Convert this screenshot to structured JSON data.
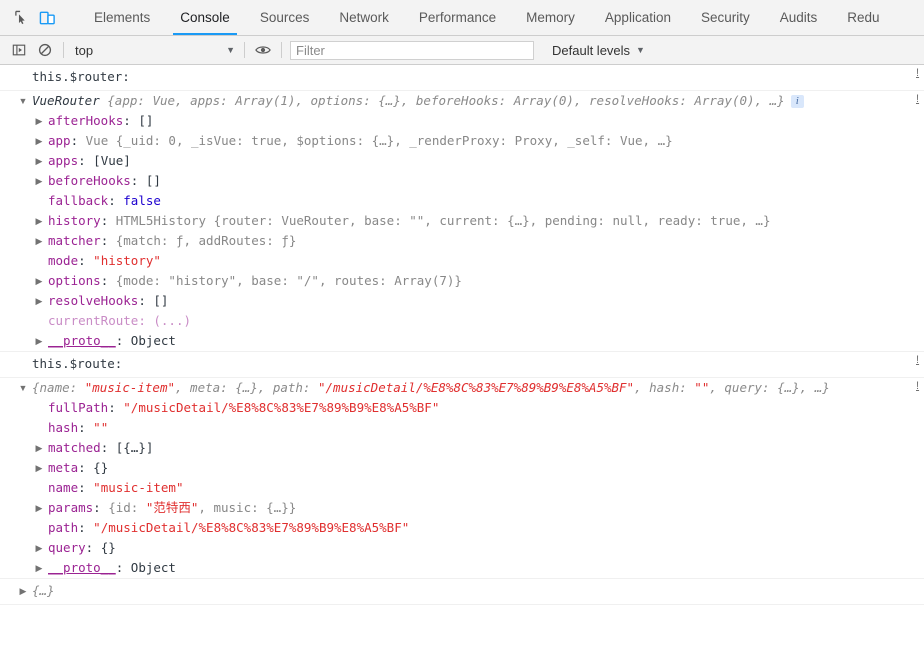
{
  "toolbar": {
    "inspect_icon": "inspect-cursor-icon",
    "device_icon": "device-toolbar-icon",
    "tabs": [
      {
        "label": "Elements",
        "active": false
      },
      {
        "label": "Console",
        "active": true
      },
      {
        "label": "Sources",
        "active": false
      },
      {
        "label": "Network",
        "active": false
      },
      {
        "label": "Performance",
        "active": false
      },
      {
        "label": "Memory",
        "active": false
      },
      {
        "label": "Application",
        "active": false
      },
      {
        "label": "Security",
        "active": false
      },
      {
        "label": "Audits",
        "active": false
      },
      {
        "label": "Redu",
        "active": false
      }
    ],
    "active_accent": "#1a9af5"
  },
  "filterbar": {
    "sidebar_icon": "console-sidebar-icon",
    "clear_icon": "clear-console-icon",
    "eye_icon": "live-expression-eye-icon",
    "context": "top",
    "context_caret": "▼",
    "filter_placeholder": "Filter",
    "filter_value": "",
    "levels": "Default levels",
    "levels_caret": "▼"
  },
  "console": {
    "entry1": {
      "command": "this.$router:",
      "source_link": "!",
      "preview": {
        "triangle": "▼",
        "class": "VueRouter",
        "open": " {",
        "segments": [
          {
            "key": "app: ",
            "val": "Vue",
            "type": "dim"
          },
          {
            "key": "apps: ",
            "val": "Array(1)",
            "type": "dim"
          },
          {
            "key": "options: ",
            "val": "{…}",
            "type": "dim"
          },
          {
            "key": "beforeHooks: ",
            "val": "Array(0)",
            "type": "dim"
          },
          {
            "key": "resolveHooks: ",
            "val": "Array(0)",
            "type": "dim"
          }
        ],
        "ellipsis": "…}",
        "badge": "i"
      },
      "rows": [
        {
          "expand": "▶",
          "name": "afterHooks",
          "value": "[]",
          "kind": "plain"
        },
        {
          "expand": "▶",
          "name": "app",
          "value": "Vue {_uid: 0, _isVue: true, $options: {…}, _renderProxy: Proxy, _self: Vue, …}",
          "kind": "object-preview"
        },
        {
          "expand": "▶",
          "name": "apps",
          "value": "[Vue]",
          "kind": "plain"
        },
        {
          "expand": "▶",
          "name": "beforeHooks",
          "value": "[]",
          "kind": "plain"
        },
        {
          "expand": "",
          "name": "fallback",
          "value": "false",
          "kind": "bool"
        },
        {
          "expand": "▶",
          "name": "history",
          "value": "HTML5History {router: VueRouter, base: \"\", current: {…}, pending: null, ready: true, …}",
          "kind": "object-preview"
        },
        {
          "expand": "▶",
          "name": "matcher",
          "value": "{match: ƒ, addRoutes: ƒ}",
          "kind": "fn-preview"
        },
        {
          "expand": "",
          "name": "mode",
          "value": "\"history\"",
          "kind": "string"
        },
        {
          "expand": "▶",
          "name": "options",
          "value": "{mode: \"history\", base: \"/\", routes: Array(7)}",
          "kind": "object-preview"
        },
        {
          "expand": "▶",
          "name": "resolveHooks",
          "value": "[]",
          "kind": "plain"
        },
        {
          "expand": "",
          "name": "currentRoute",
          "value": "(...)",
          "kind": "getter"
        },
        {
          "expand": "▶",
          "name": "__proto__",
          "value": "Object",
          "kind": "proto"
        }
      ]
    },
    "entry2": {
      "command": "this.$route:",
      "source_link": "!",
      "preview": {
        "triangle": "▼",
        "open": "{",
        "text": "name: \"music-item\", meta: {…}, path: \"/musicDetail/%E8%8C%83%E7%89%B9%E8%A5%BF\", hash: \"\", query: {…}, …}"
      },
      "rows": [
        {
          "expand": "",
          "name": "fullPath",
          "value": "\"/musicDetail/%E8%8C%83%E7%89%B9%E8%A5%BF\"",
          "kind": "string"
        },
        {
          "expand": "",
          "name": "hash",
          "value": "\"\"",
          "kind": "string"
        },
        {
          "expand": "▶",
          "name": "matched",
          "value": "[{…}]",
          "kind": "plain"
        },
        {
          "expand": "▶",
          "name": "meta",
          "value": "{}",
          "kind": "plain"
        },
        {
          "expand": "",
          "name": "name",
          "value": "\"music-item\"",
          "kind": "string"
        },
        {
          "expand": "▶",
          "name": "params",
          "value": "{id: \"范特西\", music: {…}}",
          "kind": "object-preview"
        },
        {
          "expand": "",
          "name": "path",
          "value": "\"/musicDetail/%E8%8C%83%E7%89%B9%E8%A5%BF\"",
          "kind": "string"
        },
        {
          "expand": "▶",
          "name": "query",
          "value": "{}",
          "kind": "plain"
        },
        {
          "expand": "▶",
          "name": "__proto__",
          "value": "Object",
          "kind": "proto"
        }
      ]
    },
    "entry3": {
      "triangle": "▶",
      "preview": "{…}"
    }
  }
}
